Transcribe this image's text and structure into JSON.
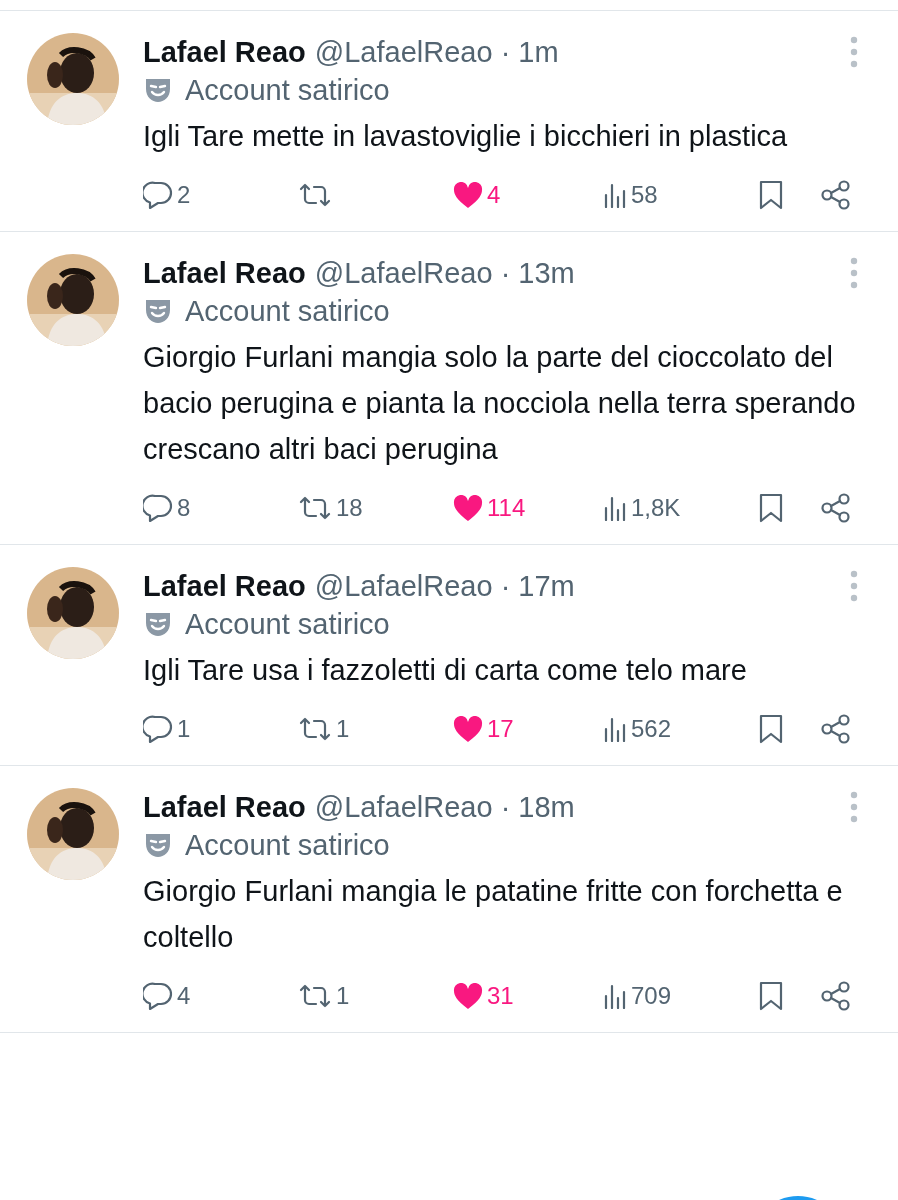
{
  "tweets": [
    {
      "name": "Lafael Reao",
      "meta": "@LafaelReao · 1m",
      "label": "Account satirico",
      "text": "Igli Tare mette in lavastoviglie i bicchieri in plastica",
      "replies": "2",
      "liked": true,
      "likes": "4",
      "views": "58"
    },
    {
      "name": "Lafael Reao",
      "meta": "@LafaelReao · 13m",
      "label": "Account satirico",
      "text": "Giorgio Furlani mangia solo la parte del cioccolato del bacio perugina e pianta la nocciola nella terra sperando crescano altri baci perugina",
      "replies": "8",
      "retweets": "18",
      "liked": true,
      "likes": "114",
      "views": "1,8K"
    },
    {
      "name": "Lafael Reao",
      "meta": "@LafaelReao · 17m",
      "label": "Account satirico",
      "text": "Igli Tare usa i fazzoletti di carta come telo mare",
      "replies": "1",
      "retweets": "1",
      "liked": true,
      "likes": "17",
      "views": "562"
    },
    {
      "name": "Lafael Reao",
      "meta": "@LafaelReao · 18m",
      "label": "Account satirico",
      "text": "Giorgio Furlani mangia le patatine fritte con forchetta e coltello",
      "replies": "4",
      "retweets": "1",
      "liked": true,
      "likes": "31",
      "views": "709"
    }
  ]
}
